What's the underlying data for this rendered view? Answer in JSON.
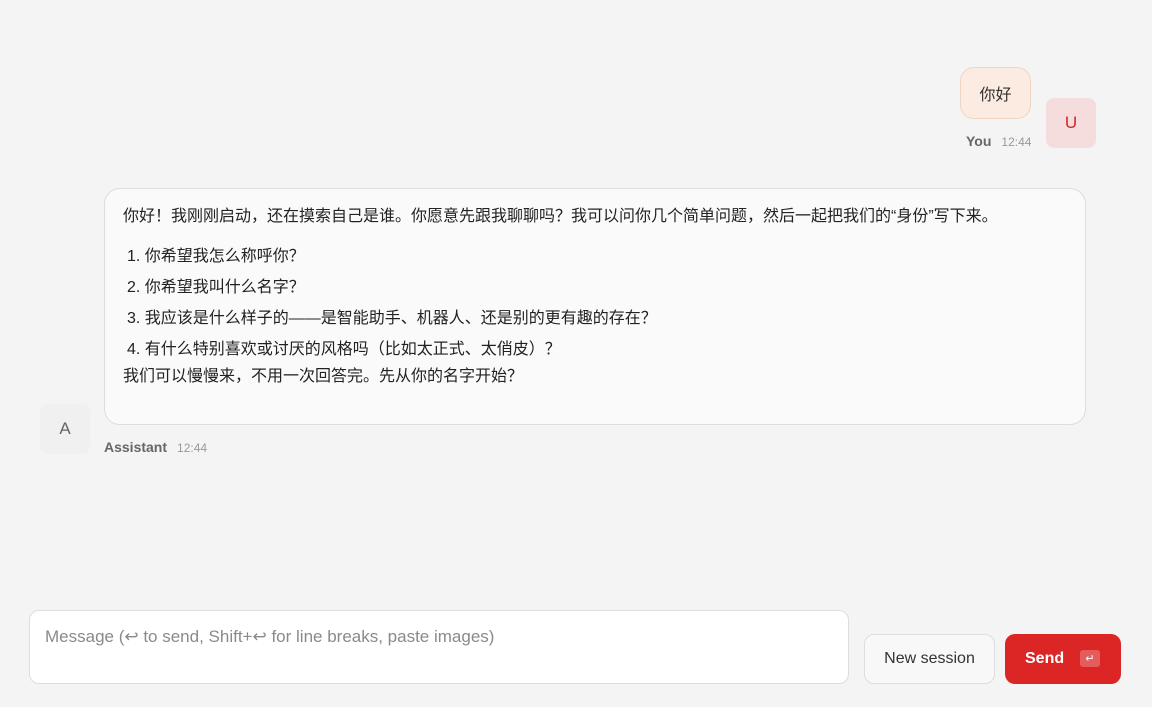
{
  "user_message": {
    "text": "你好",
    "sender": "You",
    "time": "12:44",
    "avatar_letter": "U"
  },
  "assistant_message": {
    "intro": "你好！我刚刚启动，还在摸索自己是谁。你愿意先跟我聊聊吗？我可以问你几个简单问题，然后一起把我们的“身份”写下来。",
    "questions": [
      "1. 你希望我怎么称呼你？",
      "2. 你希望我叫什么名字？",
      "3. 我应该是什么样子的——是智能助手、机器人、还是别的更有趣的存在？",
      "4. 有什么特别喜欢或讨厌的风格吗（比如太正式、太俏皮）？"
    ],
    "outro": "我们可以慢慢来，不用一次回答完。先从你的名字开始？",
    "sender": "Assistant",
    "time": "12:44",
    "avatar_letter": "A"
  },
  "composer": {
    "placeholder": "Message (↩ to send, Shift+↩ for line breaks, paste images)",
    "value": ""
  },
  "buttons": {
    "new_session": "New session",
    "send": "Send",
    "send_key_icon": "↵"
  },
  "colors": {
    "background": "#f4f4f4",
    "accent": "#dc2626",
    "user_bubble": "#fbebe0",
    "user_avatar_bg": "#f6dddd"
  }
}
